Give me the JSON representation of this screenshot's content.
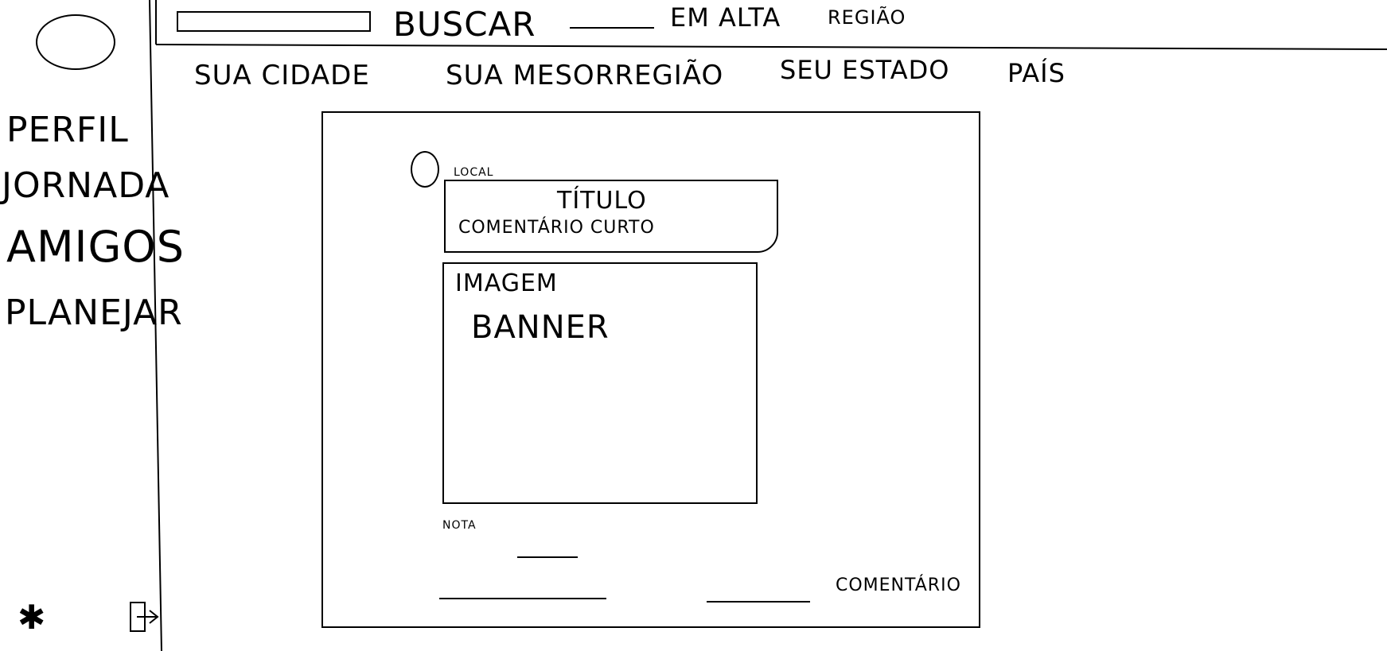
{
  "colors": {
    "ink": "#000000",
    "background": "#ffffff"
  },
  "sidebar": {
    "avatar_icon": "avatar-circle",
    "items": [
      {
        "label": "PERFIL"
      },
      {
        "label": "JORNADA"
      },
      {
        "label": "AMIGOS"
      },
      {
        "label": "PLANEJAR"
      }
    ],
    "footer_icons": [
      "asterisk-icon",
      "logout-icon"
    ]
  },
  "header": {
    "search_label": "BUSCAR",
    "trending_label": "EM ALTA",
    "region_label": "REGIÃO"
  },
  "tabs": [
    {
      "label": "SUA CIDADE"
    },
    {
      "label": "SUA MESORREGIÃO"
    },
    {
      "label": "SEU ESTADO"
    },
    {
      "label": "PAÍS"
    }
  ],
  "post": {
    "location_label": "LOCAL",
    "title_label": "TÍTULO",
    "comment_label": "COMENTÁRIO CURTO",
    "image_label": "IMAGEM",
    "banner_label": "BANNER",
    "note_label": "NOTA",
    "comments_label": "COMENTÁRIO"
  }
}
